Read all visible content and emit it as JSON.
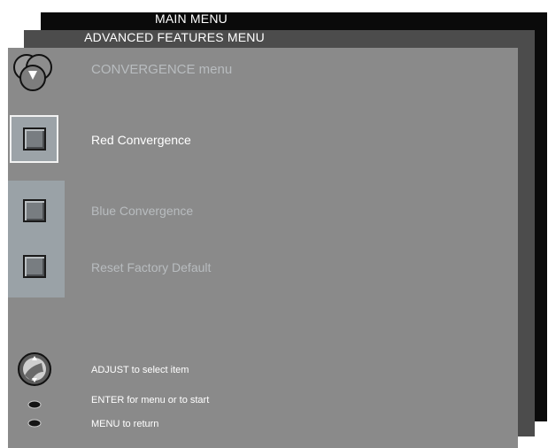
{
  "menus": {
    "main_title": "MAIN MENU",
    "advanced_title": "ADVANCED FEATURES MENU",
    "convergence_title": "CONVERGENCE menu"
  },
  "items": [
    {
      "label": "Red Convergence",
      "selected": true,
      "icon": "square-button-icon"
    },
    {
      "label": "Blue Convergence",
      "selected": false,
      "icon": "square-button-icon"
    },
    {
      "label": "Reset Factory Default",
      "selected": false,
      "icon": "square-button-icon"
    }
  ],
  "hints": {
    "adjust": "ADJUST to select item",
    "enter": "ENTER for menu or to start",
    "menu": "MENU to return"
  },
  "colors": {
    "panel": "#8a8a8a",
    "active_text": "#ffffff",
    "inactive_text": "#b8bcbf",
    "outer_menu": "#0a0a0a",
    "middle_menu": "#4c4c4c"
  },
  "icons": {
    "header": "rgb-convergence-icon",
    "adjust": "knob-icon",
    "enter": "enter-button-icon",
    "menu": "menu-button-icon"
  }
}
